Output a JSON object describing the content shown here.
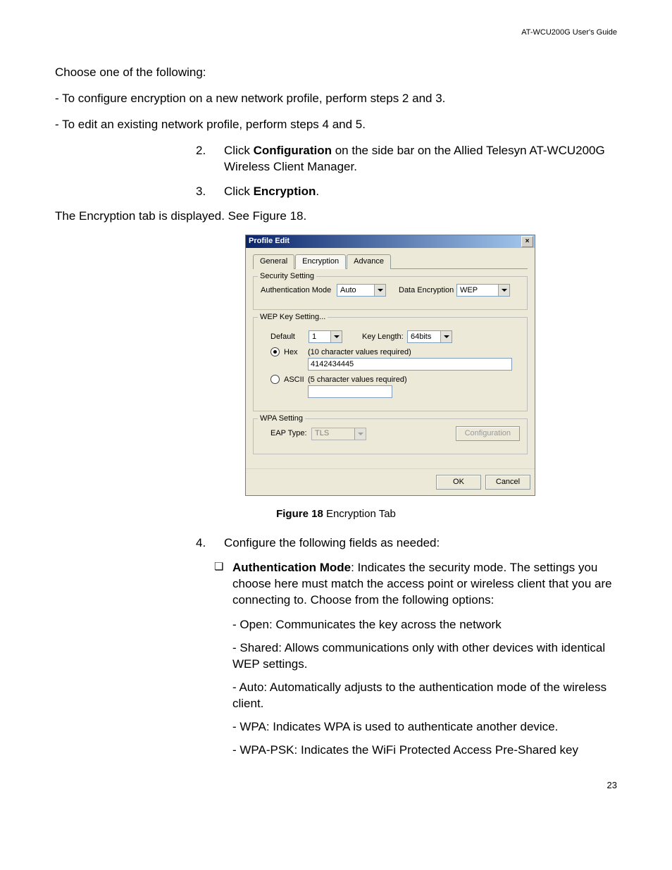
{
  "header": "AT-WCU200G User's Guide",
  "p1": "Choose one of the following:",
  "p2": "- To configure encryption on a new network profile, perform steps 2 and 3.",
  "p3": "- To edit an existing network profile, perform steps 4 and 5.",
  "step2_num": "2.",
  "step2_a": "Click ",
  "step2_b": "Configuration",
  "step2_c": " on the side bar on the Allied Telesyn AT-WCU200G Wireless Client Manager.",
  "step3_num": "3.",
  "step3_a": "Click ",
  "step3_b": "Encryption",
  "step3_c": ".",
  "p4": "The Encryption tab is displayed. See Figure 18.",
  "dialog": {
    "title": "Profile Edit",
    "tabs": {
      "general": "General",
      "encryption": "Encryption",
      "advance": "Advance"
    },
    "security": {
      "legend": "Security Setting",
      "auth_label": "Authentication Mode",
      "auth_value": "Auto",
      "enc_label": "Data Encryption",
      "enc_value": "WEP"
    },
    "wep": {
      "legend": "WEP Key Setting...",
      "default_label": "Default",
      "default_value": "1",
      "keylen_label": "Key Length:",
      "keylen_value": "64bits",
      "hex_label": "Hex",
      "hex_note": "(10 character values required)",
      "hex_value": "4142434445",
      "ascii_label": "ASCII",
      "ascii_note": "(5 character values required)",
      "ascii_value": ""
    },
    "wpa": {
      "legend": "WPA Setting",
      "eap_label": "EAP Type:",
      "eap_value": "TLS",
      "config_btn": "Configuration"
    },
    "ok": "OK",
    "cancel": "Cancel"
  },
  "fig_a": "Figure 18",
  "fig_b": "  Encryption Tab",
  "step4_num": "4.",
  "step4_text": "Configure the following fields as needed:",
  "bullet_glyph": "❏",
  "auth_bold": "Authentication Mode",
  "auth_rest": ": Indicates the security mode. The settings you choose here must match the access point or wireless client that you are connecting to. Choose from the following options:",
  "open": "- Open: Communicates the key across the network",
  "shared": "- Shared: Allows communications only with other devices with identical WEP settings.",
  "auto": "- Auto: Automatically adjusts to the authentication mode of the wireless client.",
  "wpa": "- WPA: Indicates WPA is used to authenticate another device.",
  "wpapsk": "- WPA-PSK: Indicates the WiFi Protected Access Pre-Shared key",
  "pagenum": "23"
}
